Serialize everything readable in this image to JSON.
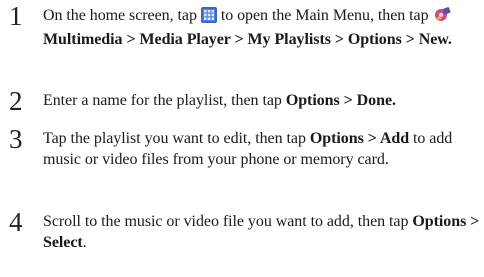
{
  "steps": [
    {
      "number": "1",
      "text_a": "On the home screen, tap",
      "icon_menu": "main-menu-grid-icon",
      "text_b": "to open the Main Menu, then tap",
      "icon_multimedia": "multimedia-icon",
      "path": "Multimedia > Media Player > My Playlists > Options > New."
    },
    {
      "number": "2",
      "text": "Enter a name for the playlist, then tap",
      "bold": "Options > Done."
    },
    {
      "number": "3",
      "text_a": "Tap the playlist you want to edit, then tap",
      "bold": "Options > Add",
      "text_b": "to add music or video files from your phone or memory card."
    },
    {
      "number": "4",
      "text_a": "Scroll to the music or video file you want to add, then tap",
      "bold": "Options > Select",
      "text_b": "."
    }
  ],
  "colors": {
    "menu_icon_blue": "#3a64c8",
    "text": "#1a1a1a"
  }
}
